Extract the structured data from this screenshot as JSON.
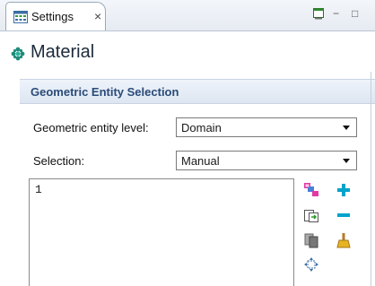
{
  "tab": {
    "title": "Settings",
    "close": "×"
  },
  "window_controls": {
    "new_window_icon": "new-window-icon",
    "minimize": "−",
    "maximize": "□"
  },
  "header": {
    "title": "Material",
    "icon": "material-icon"
  },
  "section": {
    "title": "Geometric Entity Selection"
  },
  "fields": {
    "entity_level": {
      "label": "Geometric entity level:",
      "value": "Domain"
    },
    "selection": {
      "label": "Selection:",
      "value": "Manual"
    }
  },
  "selection_list": {
    "items": [
      "1"
    ]
  },
  "toolbar": {
    "icons": [
      "select-objects-icon",
      "add-icon",
      "paste-icon",
      "remove-icon",
      "copy-icon",
      "clear-icon",
      "zoom-to-selection-icon"
    ]
  },
  "colors": {
    "accent": "#2b4b78",
    "add": "#00a3cc"
  }
}
